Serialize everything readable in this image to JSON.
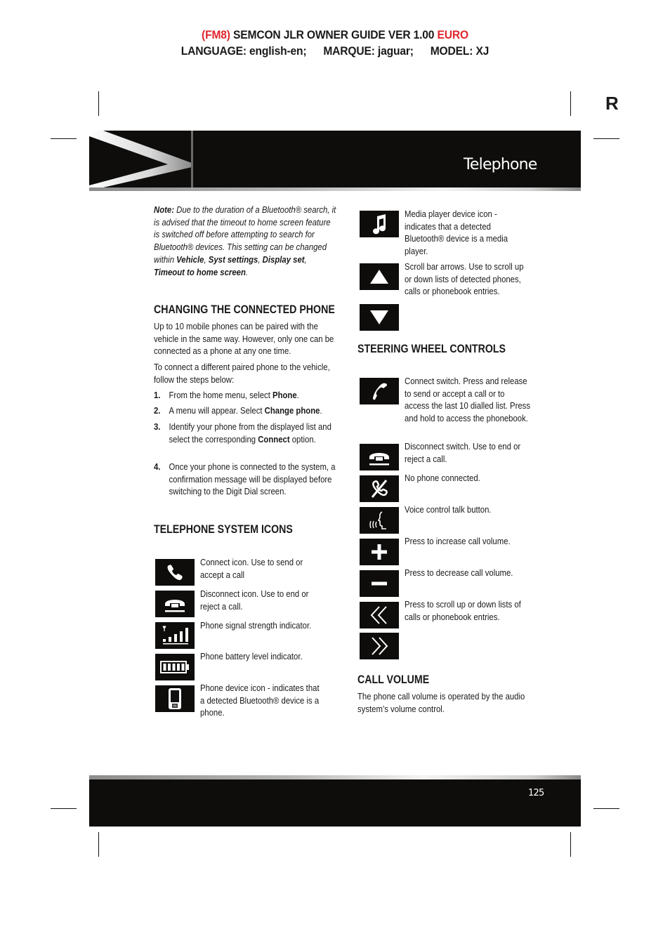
{
  "doc_header": {
    "line1_prefix": "(FM8)",
    "line1_main": "SEMCON JLR OWNER GUIDE VER 1.00",
    "line1_suffix": "EURO",
    "language": "LANGUAGE: english-en;",
    "marque": "MARQUE: jaguar;",
    "model": "MODEL: XJ",
    "accent_color": "#e0272f"
  },
  "tab_letter": "R",
  "banner": {
    "title": "Telephone"
  },
  "note": {
    "label": "Note:",
    "text": " Due to the duration of a Bluetooth® search, it is advised that the timeout to home screen feature is switched off before attempting to search for Bluetooth® devices. This setting can be changed within ",
    "path": [
      "Vehicle",
      "Syst settings",
      "Display set",
      "Timeout to home screen"
    ],
    "sep": ", ",
    "end": "."
  },
  "changing": {
    "heading": "CHANGING THE CONNECTED PHONE",
    "para1": "Up to 10 mobile phones can be paired with the vehicle in the same way. However, only one can be connected as a phone at any one time.",
    "para2": "To connect a different paired phone to the vehicle, follow the steps below:",
    "steps": [
      {
        "num": "1.",
        "pre": "From the home menu, select ",
        "bold": "Phone",
        "post": "."
      },
      {
        "num": "2.",
        "pre": "A menu will appear. Select ",
        "bold": "Change phone",
        "post": "."
      },
      {
        "num": "3.",
        "pre": "Identify your phone from the displayed list and select the corresponding ",
        "bold": "Connect",
        "post": " option."
      },
      {
        "num": "4.",
        "pre": "Once your phone is connected to the system, a confirmation message will be displayed before switching to the Digit Dial screen.",
        "bold": "",
        "post": ""
      }
    ]
  },
  "system_icons": {
    "heading": "TELEPHONE SYSTEM ICONS",
    "items": [
      {
        "icon": "phone-connect-icon",
        "desc": "Connect icon. Use to send or accept a call"
      },
      {
        "icon": "phone-disconnect-icon",
        "desc": "Disconnect icon. Use to end or reject a call."
      },
      {
        "icon": "signal-strength-icon",
        "desc": "Phone signal strength indicator."
      },
      {
        "icon": "battery-level-icon",
        "desc": "Phone battery level indicator."
      },
      {
        "icon": "phone-device-icon",
        "desc": "Phone device icon - indicates that a detected Bluetooth® device is a phone."
      },
      {
        "icon": "music-note-icon",
        "desc": "Media player device icon - indicates that a detected Bluetooth® device is a media player."
      },
      {
        "icon": "arrow-up-icon",
        "desc": "Scroll bar arrows. Use to scroll up or down lists of detected phones, calls or phonebook entries."
      },
      {
        "icon": "arrow-down-icon",
        "desc": ""
      }
    ]
  },
  "steering": {
    "heading": "STEERING WHEEL CONTROLS",
    "items": [
      {
        "icon": "connect-switch-icon",
        "desc": "Connect switch. Press and release to send or accept a call or to access the last 10 dialled list. Press and hold to access the phonebook."
      },
      {
        "icon": "disconnect-switch-icon",
        "desc": "Disconnect switch. Use to end or reject a call."
      },
      {
        "icon": "no-phone-icon",
        "desc": "No phone connected."
      },
      {
        "icon": "voice-talk-icon",
        "desc": "Voice control talk button."
      },
      {
        "icon": "plus-icon",
        "desc": "Press to increase call volume."
      },
      {
        "icon": "minus-icon",
        "desc": "Press to decrease call volume."
      },
      {
        "icon": "double-chevron-left-icon",
        "desc": "Press to scroll up or down lists of calls or phonebook entries."
      },
      {
        "icon": "double-chevron-right-icon",
        "desc": ""
      }
    ]
  },
  "call_volume": {
    "heading": "CALL VOLUME",
    "text": "The phone call volume is operated by the audio system’s volume control."
  },
  "footer": {
    "page_number": "125"
  }
}
